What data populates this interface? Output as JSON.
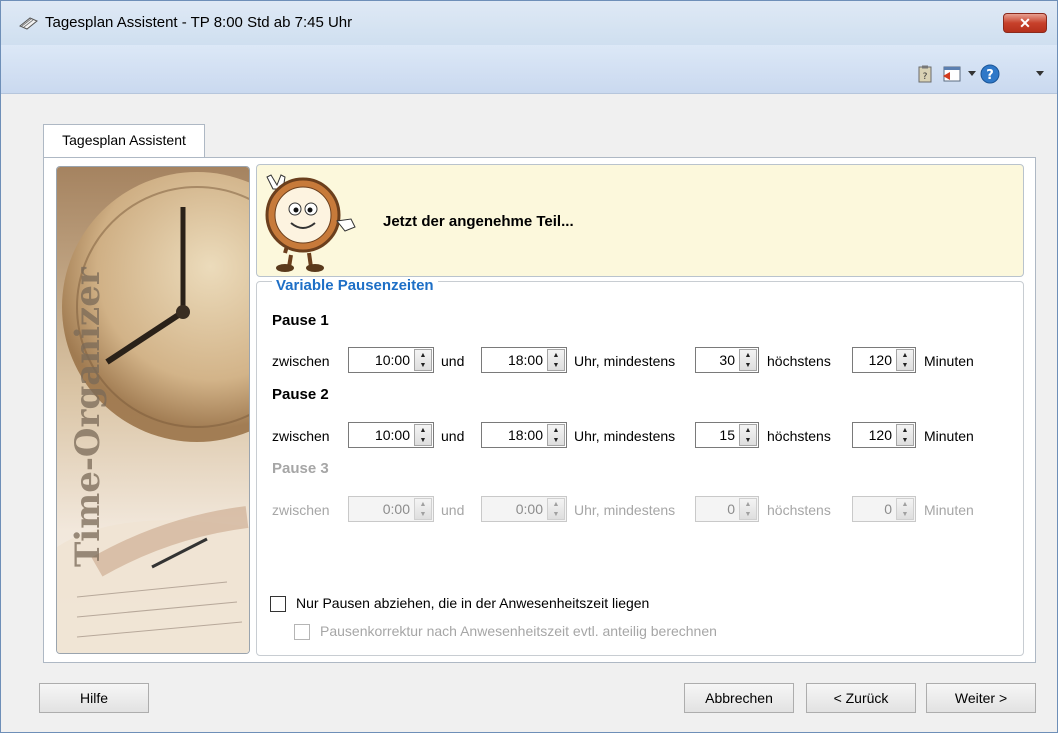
{
  "window": {
    "title": "Tagesplan Assistent - TP 8:00 Std ab 7:45 Uhr",
    "close_label": "✕"
  },
  "tab": {
    "label": "Tagesplan Assistent"
  },
  "side_image": {
    "text": "Time-Organizer"
  },
  "header": {
    "title": "Jetzt der angenehme Teil..."
  },
  "section": {
    "title": "Variable Pausenzeiten"
  },
  "labels": {
    "zwischen": "zwischen",
    "und": "und",
    "uhr_mindestens": "Uhr, mindestens",
    "hoechstens": "höchstens",
    "minuten": "Minuten"
  },
  "pauses": [
    {
      "label": "Pause 1",
      "from": "10:00",
      "to": "18:00",
      "min": "30",
      "max": "120",
      "enabled": true
    },
    {
      "label": "Pause 2",
      "from": "10:00",
      "to": "18:00",
      "min": "15",
      "max": "120",
      "enabled": true
    },
    {
      "label": "Pause 3",
      "from": "0:00",
      "to": "0:00",
      "min": "0",
      "max": "0",
      "enabled": false
    }
  ],
  "options": {
    "only_presence": {
      "label": "Nur Pausen abziehen, die in der Anwesenheitszeit liegen",
      "checked": false
    },
    "proportional": {
      "label": "Pausenkorrektur nach Anwesenheitszeit evtl. anteilig berechnen",
      "checked": false,
      "enabled": false
    }
  },
  "buttons": {
    "help": "Hilfe",
    "cancel": "Abbrechen",
    "back": "< Zurück",
    "next": "Weiter >"
  },
  "icons": {
    "title": "notebook-pen-icon",
    "toolbar": [
      "clipboard-icon",
      "window-exit-icon",
      "help-icon"
    ]
  }
}
